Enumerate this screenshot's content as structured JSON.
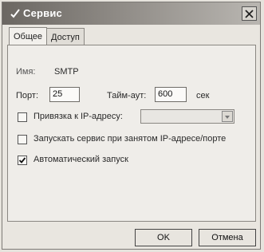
{
  "window": {
    "title": "Сервис"
  },
  "tabs": [
    {
      "label": "Общее",
      "active": true
    },
    {
      "label": "Доступ",
      "active": false
    }
  ],
  "general": {
    "name_label": "Имя:",
    "name_value": "SMTP",
    "port_label": "Порт:",
    "port_value": "25",
    "timeout_label": "Тайм-аут:",
    "timeout_value": "600",
    "timeout_unit": "сек",
    "bind_ip_label": "Привязка к IP-адресу:",
    "bind_ip_checked": false,
    "bind_ip_value": "",
    "start_when_busy_label": "Запускать сервис при занятом IP-адресе/порте",
    "start_when_busy_checked": false,
    "autostart_label": "Автоматический запуск",
    "autostart_checked": true
  },
  "buttons": {
    "ok": "OK",
    "cancel": "Отмена"
  },
  "colors": {
    "titlebar_dark": "#6b6762",
    "titlebar_light": "#b9b6b1",
    "dialog_bg": "#e9e6e0"
  }
}
